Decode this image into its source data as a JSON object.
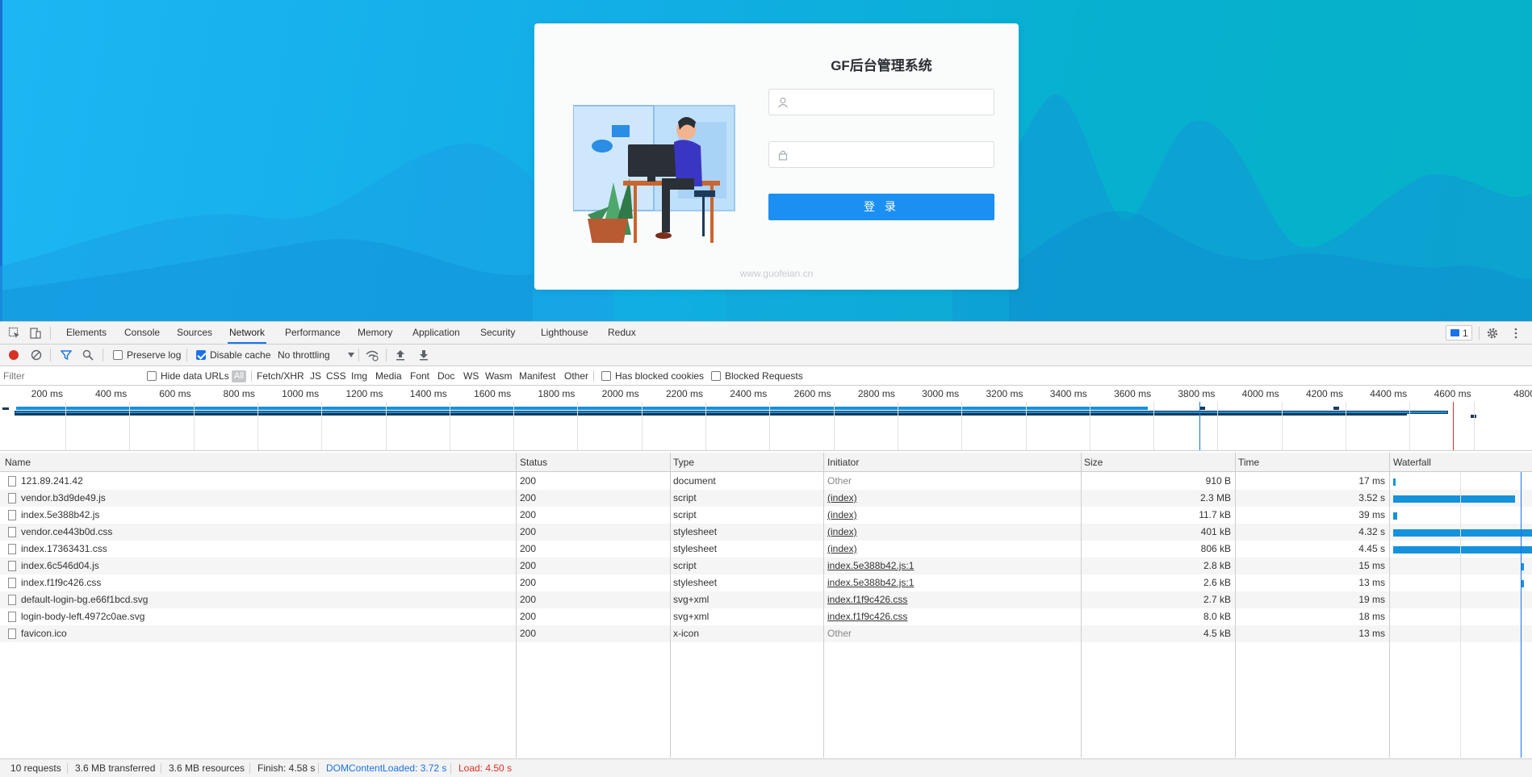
{
  "login": {
    "title": "GF后台管理系统",
    "username_value": "",
    "password_value": "",
    "login_button": "登 录",
    "site": "www.guofeian.cn"
  },
  "devtools": {
    "tabs": [
      "Elements",
      "Console",
      "Sources",
      "Network",
      "Performance",
      "Memory",
      "Application",
      "Security",
      "Lighthouse",
      "Redux"
    ],
    "active_tab": "Network",
    "message_count": "1",
    "toolbar": {
      "preserve_log": "Preserve log",
      "disable_cache": "Disable cache",
      "throttling": "No throttling"
    },
    "filter": {
      "placeholder": "Filter",
      "hide_data_urls": "Hide data URLs",
      "all": "All",
      "types": [
        "Fetch/XHR",
        "JS",
        "CSS",
        "Img",
        "Media",
        "Font",
        "Doc",
        "WS",
        "Wasm",
        "Manifest",
        "Other"
      ],
      "has_blocked_cookies": "Has blocked cookies",
      "blocked_requests": "Blocked Requests"
    },
    "overview_ticks": [
      "200 ms",
      "400 ms",
      "600 ms",
      "800 ms",
      "1000 ms",
      "1200 ms",
      "1400 ms",
      "1600 ms",
      "1800 ms",
      "2000 ms",
      "2200 ms",
      "2400 ms",
      "2600 ms",
      "2800 ms",
      "3000 ms",
      "3200 ms",
      "3400 ms",
      "3600 ms",
      "3800 ms",
      "4000 ms",
      "4200 ms",
      "4400 ms",
      "4600 ms",
      "4800"
    ],
    "columns": {
      "name": "Name",
      "status": "Status",
      "type": "Type",
      "initiator": "Initiator",
      "size": "Size",
      "time": "Time",
      "waterfall": "Waterfall"
    },
    "requests": [
      {
        "name": "121.89.241.42",
        "status": "200",
        "type": "document",
        "initiator": "Other",
        "size": "910 B",
        "time": "17 ms"
      },
      {
        "name": "vendor.b3d9de49.js",
        "status": "200",
        "type": "script",
        "initiator": "(index)",
        "size": "2.3 MB",
        "time": "3.52 s"
      },
      {
        "name": "index.5e388b42.js",
        "status": "200",
        "type": "script",
        "initiator": "(index)",
        "size": "11.7 kB",
        "time": "39 ms"
      },
      {
        "name": "vendor.ce443b0d.css",
        "status": "200",
        "type": "stylesheet",
        "initiator": "(index)",
        "size": "401 kB",
        "time": "4.32 s"
      },
      {
        "name": "index.17363431.css",
        "status": "200",
        "type": "stylesheet",
        "initiator": "(index)",
        "size": "806 kB",
        "time": "4.45 s"
      },
      {
        "name": "index.6c546d04.js",
        "status": "200",
        "type": "script",
        "initiator": "index.5e388b42.js:1",
        "size": "2.8 kB",
        "time": "15 ms"
      },
      {
        "name": "index.f1f9c426.css",
        "status": "200",
        "type": "stylesheet",
        "initiator": "index.5e388b42.js:1",
        "size": "2.6 kB",
        "time": "13 ms"
      },
      {
        "name": "default-login-bg.e66f1bcd.svg",
        "status": "200",
        "type": "svg+xml",
        "initiator": "index.f1f9c426.css",
        "size": "2.7 kB",
        "time": "19 ms"
      },
      {
        "name": "login-body-left.4972c0ae.svg",
        "status": "200",
        "type": "svg+xml",
        "initiator": "index.f1f9c426.css",
        "size": "8.0 kB",
        "time": "18 ms"
      },
      {
        "name": "favicon.ico",
        "status": "200",
        "type": "x-icon",
        "initiator": "Other",
        "size": "4.5 kB",
        "time": "13 ms"
      }
    ],
    "status_bar": {
      "requests": "10 requests",
      "transferred": "3.6 MB transferred",
      "resources": "3.6 MB resources",
      "finish": "Finish: 4.58 s",
      "dom_content_loaded": "DOMContentLoaded: 3.72 s",
      "load": "Load: 4.50 s"
    },
    "colors": {
      "accent": "#1a73e8",
      "dcl": "#1a73e8",
      "load": "#d93025",
      "bar": "#1592dc"
    }
  }
}
